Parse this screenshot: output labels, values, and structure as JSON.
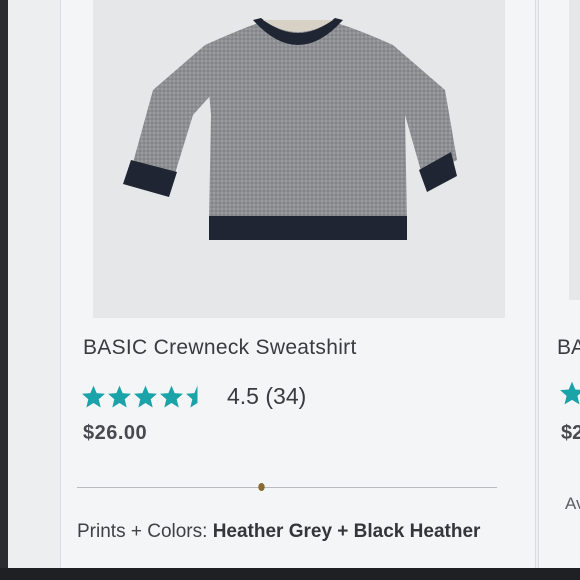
{
  "product": {
    "title": "BASIC Crewneck Sweatshirt",
    "rating_value": 4.5,
    "rating_text": "4.5 (34)",
    "price": "$26.00",
    "colors_label": "Prints + Colors:",
    "colors_value": "Heather Grey + Black Heather",
    "image_icon": "sweatshirt-image"
  },
  "next_product": {
    "title_fragment": "BA",
    "price_fragment": "$2",
    "availability_fragment": "Av"
  },
  "colors": {
    "star": "#1aa3a8",
    "text": "#3a3b3e",
    "card_background": "#f4f5f6"
  }
}
